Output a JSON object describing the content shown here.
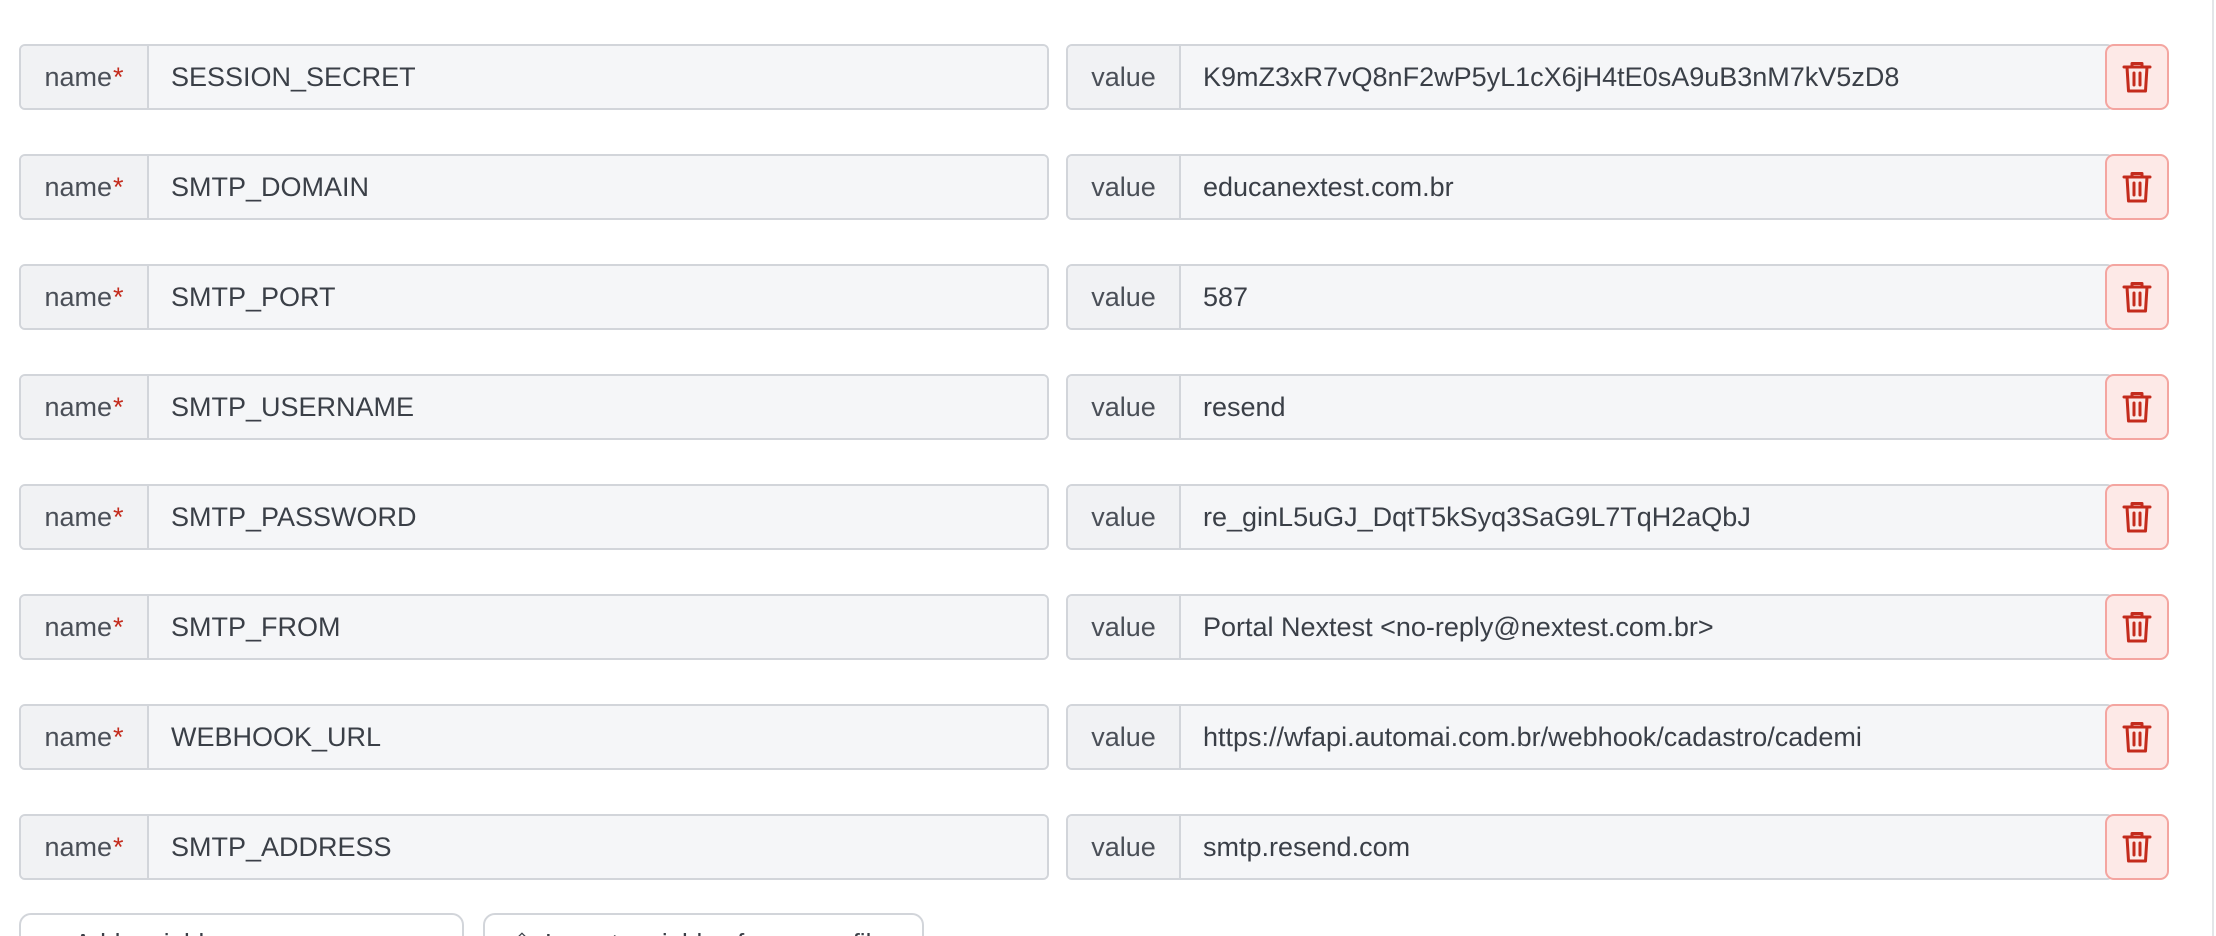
{
  "labels": {
    "name": "name",
    "required_mark": "*",
    "value": "value"
  },
  "variables": [
    {
      "name": "SESSION_SECRET",
      "value": "K9mZ3xR7vQ8nF2wP5yL1cX6jH4tE0sA9uB3nM7kV5zD8"
    },
    {
      "name": "SMTP_DOMAIN",
      "value": "educanextest.com.br"
    },
    {
      "name": "SMTP_PORT",
      "value": "587"
    },
    {
      "name": "SMTP_USERNAME",
      "value": "resend"
    },
    {
      "name": "SMTP_PASSWORD",
      "value": "re_ginL5uGJ_DqtT5kSyq3SaG9L7TqH2aQbJ"
    },
    {
      "name": "SMTP_FROM",
      "value": "Portal Nextest <no-reply@nextest.com.br>"
    },
    {
      "name": "WEBHOOK_URL",
      "value": "https://wfapi.automai.com.br/webhook/cadastro/cademi"
    },
    {
      "name": "SMTP_ADDRESS",
      "value": "smtp.resend.com"
    }
  ],
  "delete_icon": "trash-icon",
  "actions": {
    "add_label": "Add variable",
    "import_label": "Import variables from .env file"
  },
  "colors": {
    "danger": "#c42b1c",
    "danger_bg": "#fde9e7",
    "border": "#d2d5da"
  }
}
